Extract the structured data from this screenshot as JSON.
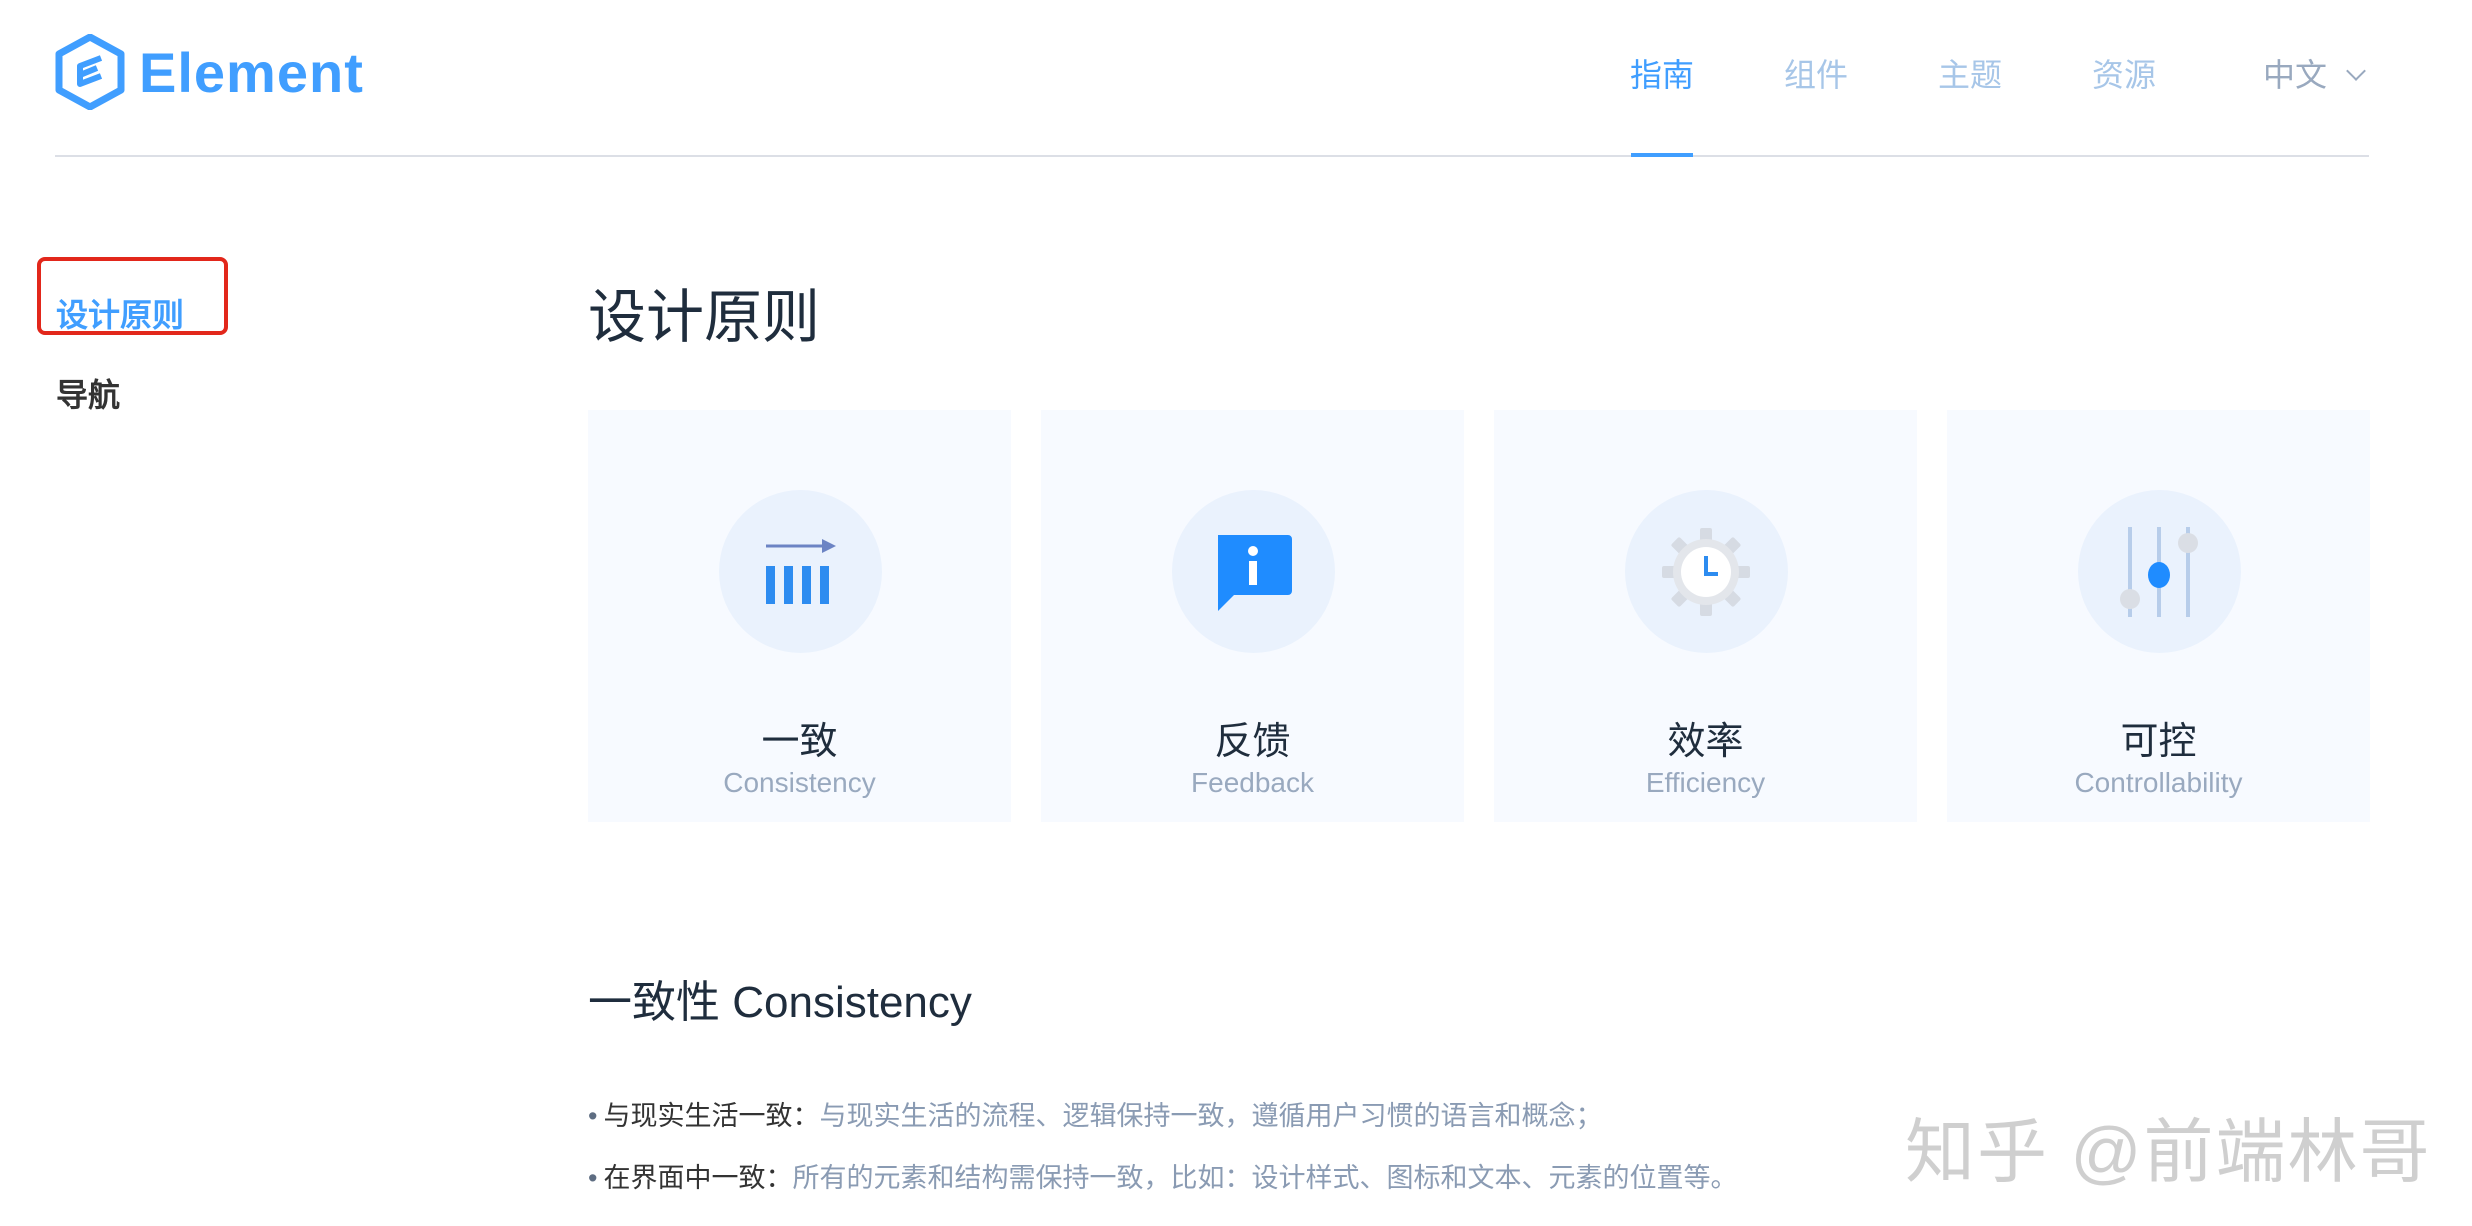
{
  "header": {
    "logo_text": "Element",
    "nav": [
      {
        "label": "指南",
        "active": true
      },
      {
        "label": "组件",
        "active": false
      },
      {
        "label": "主题",
        "active": false
      },
      {
        "label": "资源",
        "active": false
      }
    ],
    "language": "中文"
  },
  "sidebar": {
    "items": [
      {
        "label": "设计原则",
        "active": true
      },
      {
        "label": "导航",
        "active": false
      }
    ]
  },
  "main": {
    "title": "设计原则",
    "cards": [
      {
        "cn": "一致",
        "en": "Consistency",
        "icon": "consistency-icon"
      },
      {
        "cn": "反馈",
        "en": "Feedback",
        "icon": "feedback-info-icon"
      },
      {
        "cn": "效率",
        "en": "Efficiency",
        "icon": "gear-clock-icon"
      },
      {
        "cn": "可控",
        "en": "Controllability",
        "icon": "sliders-icon"
      }
    ],
    "section": {
      "title": "一致性 Consistency",
      "bullets": [
        {
          "lead": "与现实生活一致：",
          "desc": "与现实生活的流程、逻辑保持一致，遵循用户习惯的语言和概念；"
        },
        {
          "lead": "在界面中一致：",
          "desc": "所有的元素和结构需保持一致，比如：设计样式、图标和文本、元素的位置等。"
        }
      ]
    }
  },
  "watermark": "知乎 @前端林哥",
  "colors": {
    "brand": "#409eff",
    "highlight": "#e2271b",
    "card_bg": "#f7faff"
  }
}
